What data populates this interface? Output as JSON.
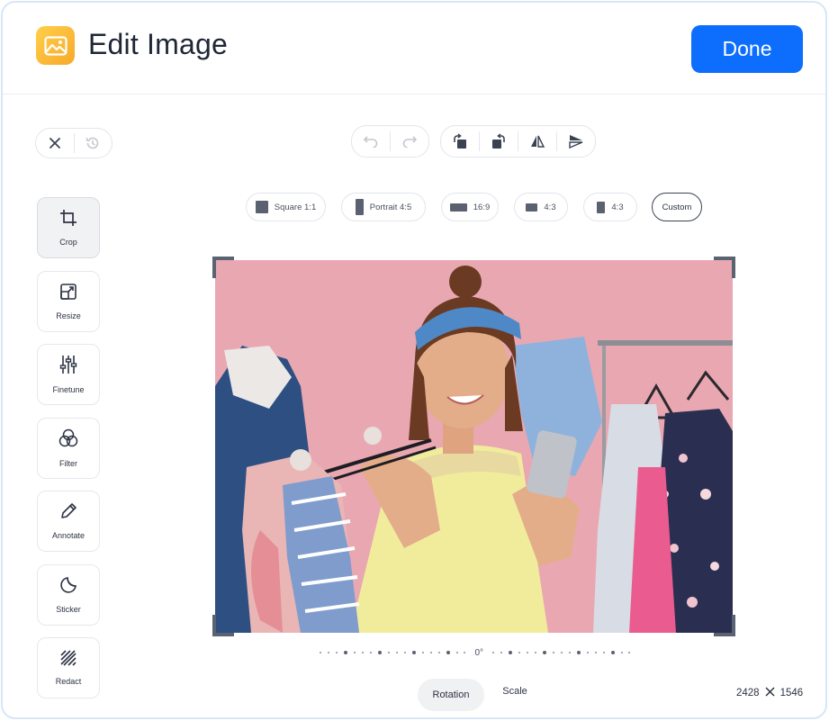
{
  "header": {
    "title": "Edit Image",
    "done_label": "Done",
    "accent": "#0d6efd",
    "app_icon": "image-icon"
  },
  "history": {
    "close_icon": "close-icon",
    "revert_icon": "history-icon"
  },
  "edit_toolbar": {
    "undo_icon": "undo-icon",
    "redo_icon": "redo-icon",
    "rotate_left_icon": "rotate-left-icon",
    "rotate_right_icon": "rotate-right-icon",
    "flip_horizontal_icon": "flip-horizontal-icon",
    "flip_vertical_icon": "flip-vertical-icon"
  },
  "tools": [
    {
      "label": "Crop",
      "icon": "crop-icon",
      "active": true
    },
    {
      "label": "Resize",
      "icon": "resize-icon"
    },
    {
      "label": "Finetune",
      "icon": "sliders-icon"
    },
    {
      "label": "Filter",
      "icon": "filter-icon"
    },
    {
      "label": "Annotate",
      "icon": "pencil-icon"
    },
    {
      "label": "Sticker",
      "icon": "sticker-icon"
    },
    {
      "label": "Redact",
      "icon": "redact-icon"
    }
  ],
  "crop_ratios": [
    {
      "label": "Square 1:1"
    },
    {
      "label": "Portrait 4:5"
    },
    {
      "label": "16:9"
    },
    {
      "label": "4:3"
    },
    {
      "label": "4:3"
    },
    {
      "label": "Custom",
      "active": true
    }
  ],
  "rotation": {
    "value": "0°"
  },
  "bottom_tabs": {
    "rotation": "Rotation",
    "scale": "Scale"
  },
  "dimensions": {
    "width": "2428",
    "height": "1546",
    "separator_icon": "times-icon"
  }
}
